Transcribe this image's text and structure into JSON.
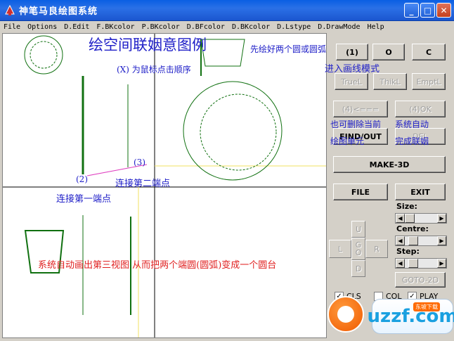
{
  "window": {
    "title": "神笔马良绘图系统",
    "buttons": {
      "minimize": "_",
      "maximize": "□",
      "close": "✕"
    }
  },
  "menu": [
    "File",
    "Options",
    "D.Edit",
    "F.BKcolor",
    "P.BKcolor",
    "D.BFcolor",
    "D.BKcolor",
    "D.Lstype",
    "D.DrawMode",
    "Help"
  ],
  "canvas": {
    "title": "绘空间联姻意图例",
    "note_click": "(X) 为鼠标点击顺序",
    "point2": "(2)",
    "point3": "(3)",
    "connect_second": "连接第二端点",
    "connect_first": "连接第一端点",
    "auto_third_view": "系统自动画出第三视图  从而把两个端圆(圆弧)变成一个圆台"
  },
  "panel": {
    "draw_circles_first": "先绘好两个圆或圆弧",
    "point1": "(1)",
    "enter_curve_mode": "进入画线模式",
    "btn_1": "(1)",
    "btn_o": "O",
    "btn_c": "C",
    "btn_truel": "TrueL",
    "btn_thikl": "ThikL",
    "btn_emptl": "EmptL",
    "btn_back": "(4)<===",
    "btn_ok": "(4)OK",
    "can_delete": "也可删除当前",
    "auto_system": "系统自动",
    "btn_findout": "FIND/OUT",
    "btn_del": "DEL",
    "draw_unit": "绘图单元",
    "complete_marriage": "完成联姻",
    "btn_make3d": "MAKE-3D",
    "btn_file": "FILE",
    "btn_exit": "EXIT",
    "size_label": "Size:",
    "centre_label": "Centre:",
    "step_label": "Step:",
    "size_value": 0.0,
    "centre_value": 0.15,
    "step_value": 0.15,
    "pad_u": "U",
    "pad_go": "G\nO",
    "pad_l": "L",
    "pad_r": "R",
    "pad_d": "D",
    "btn_goto2d": "GOTO-2D",
    "chk_cls": "CLS",
    "chk_col": "COL",
    "chk_play": "PLAY",
    "cls_checked": true,
    "col_checked": false,
    "play_checked": true
  },
  "watermark": {
    "text": "uzzf.com",
    "tag": "东坡下载"
  }
}
